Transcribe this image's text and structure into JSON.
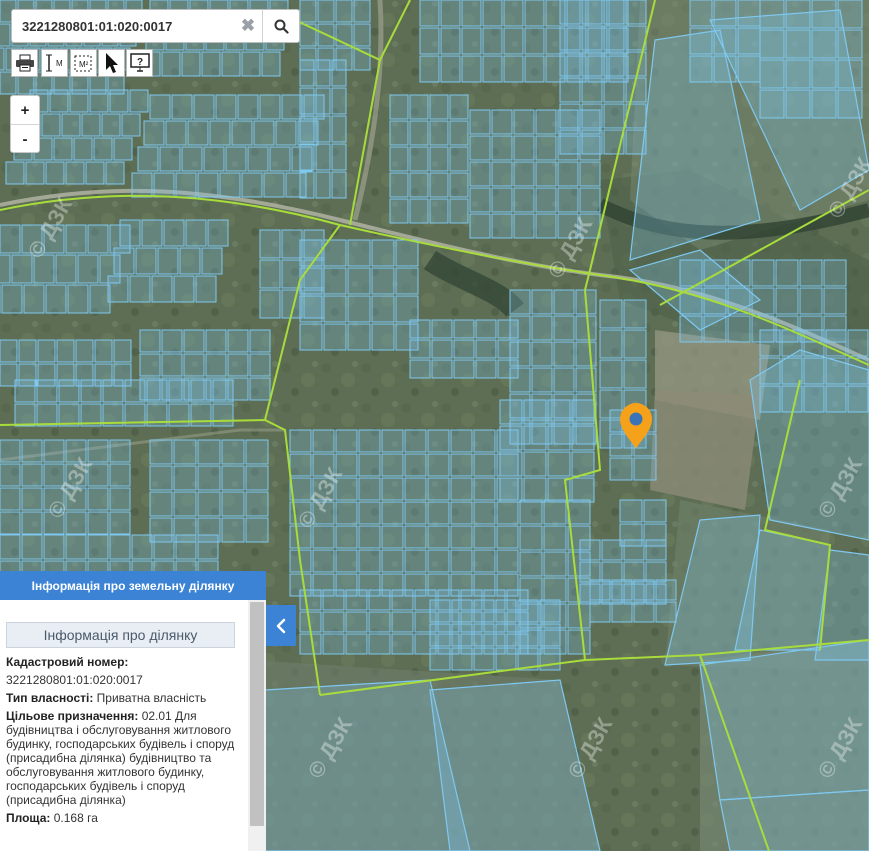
{
  "search": {
    "value": "3221280801:01:020:0017",
    "clear_icon": "close-icon",
    "search_icon": "search-icon"
  },
  "toolbar": [
    {
      "icon": "print-icon"
    },
    {
      "icon": "measure-length-icon",
      "label": "M"
    },
    {
      "icon": "measure-area-icon",
      "label": "M²"
    },
    {
      "icon": "pointer-icon"
    },
    {
      "icon": "help-icon",
      "label": "?"
    }
  ],
  "zoom": {
    "in_label": "+",
    "out_label": "-"
  },
  "map": {
    "watermark": "© ДЗК",
    "marker_icon": "location-pin-icon",
    "colors": {
      "parcel": "#7fc8f0",
      "boundary": "#a8dc3c",
      "marker": "#f5a21a"
    }
  },
  "panel": {
    "header": "Інформація про земельну ділянку",
    "subheader": "Інформація про ділянку",
    "cadastral_label": "Кадастровий номер:",
    "cadastral_value": "3221280801:01:020:0017",
    "ownership_label": "Тип власності:",
    "ownership_value": "Приватна власність",
    "purpose_label": "Цільове призначення:",
    "purpose_value": "02.01 Для будівництва і обслуговування житлового будинку, господарських будівель і споруд (присадибна ділянка) будівництво та обслуговування житлового будинку, господарських будівель і споруд (присадибна ділянка)",
    "area_label": "Площа:",
    "area_value": "0.168 га",
    "toggle_icon": "chevron-left-icon"
  }
}
